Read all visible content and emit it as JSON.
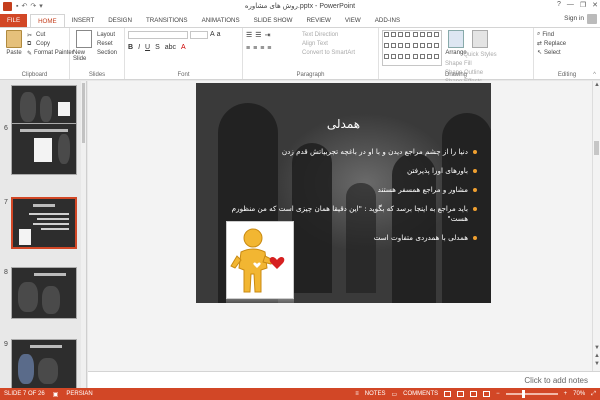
{
  "window": {
    "title": "روش های مشاوره.pptx - PowerPoint",
    "controls": [
      "?",
      "—",
      "❐",
      "✕"
    ]
  },
  "tabs": [
    "FILE",
    "HOME",
    "INSERT",
    "DESIGN",
    "TRANSITIONS",
    "ANIMATIONS",
    "SLIDE SHOW",
    "REVIEW",
    "VIEW",
    "ADD-INS"
  ],
  "active_tab": "HOME",
  "account": {
    "signin": "Sign in"
  },
  "ribbon": {
    "clipboard": {
      "paste": "Paste",
      "cut": "Cut",
      "copy": "Copy",
      "format_painter": "Format Painter",
      "label": "Clipboard"
    },
    "slides": {
      "new_slide": "New Slide",
      "layout": "Layout",
      "reset": "Reset",
      "section": "Section",
      "label": "Slides"
    },
    "font": {
      "label": "Font"
    },
    "paragraph": {
      "text_direction": "Text Direction",
      "align_text": "Align Text",
      "convert_smartart": "Convert to SmartArt",
      "label": "Paragraph"
    },
    "drawing": {
      "arrange": "Arrange",
      "quick_styles": "Quick Styles",
      "shape_fill": "Shape Fill",
      "shape_outline": "Shape Outline",
      "shape_effects": "Shape Effects",
      "label": "Drawing"
    },
    "editing": {
      "find": "Find",
      "replace": "Replace",
      "select": "Select",
      "label": "Editing"
    }
  },
  "thumbnails": [
    {
      "num": ""
    },
    {
      "num": "6"
    },
    {
      "num": "7",
      "selected": true
    },
    {
      "num": "8"
    },
    {
      "num": "9"
    }
  ],
  "slide": {
    "title": "همدلی",
    "bullets": [
      "دنیا را از چشم مراجع دیدن و با او در باغچه تجربیاتش قدم زدن",
      "باورهای اورا پذیرفتن",
      "مشاور و مراجع همسفر هستند",
      "باید مراجع به اینجا برسد که بگوید : \"این دقیقا همان چیزی است که من منظورم هست\"",
      "همدلی با همدردی متفاوت است"
    ]
  },
  "notes": {
    "placeholder": "Click to add notes"
  },
  "status": {
    "slide_info": "SLIDE 7 OF 26",
    "language": "PERSIAN",
    "notes": "NOTES",
    "comments": "COMMENTS",
    "zoom": "70%",
    "zoom_level_percent": 70
  },
  "colors": {
    "accent": "#d24726",
    "bullet": "#f0a030"
  }
}
